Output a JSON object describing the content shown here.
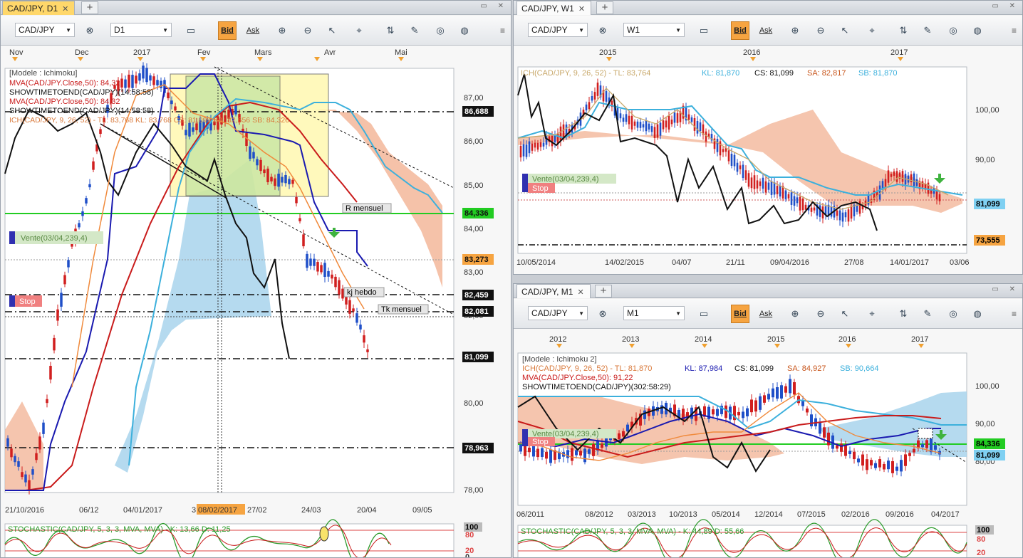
{
  "windows": {
    "d1": {
      "tab_title": "CAD/JPY, D1",
      "symbol": "CAD/JPY",
      "timeframe": "D1",
      "bid_label": "Bid",
      "ask_label": "Ask",
      "top_axis": [
        "Nov",
        "Dec",
        "2017",
        "Fev",
        "Mars",
        "Avr",
        "Mai"
      ],
      "bottom_axis": [
        "21/10/2016",
        "06/12",
        "04/01/2017",
        "3",
        "08/02/2017",
        "27/02",
        "24/03",
        "20/04",
        "09/05"
      ],
      "price_ticks": [
        "87,00",
        "86,00",
        "85,00",
        "84,00",
        "83,00",
        "82,00",
        "80,00",
        "78,00"
      ],
      "price_flags": [
        "86,688",
        "84,336",
        "83,273",
        "82,459",
        "82,081",
        "81,099",
        "78,963"
      ],
      "legend": [
        "[Modele : Ichimoku]",
        "MVA(CAD/JPY.Close,50): 84,32",
        "SHOWTIMETOEND(CAD/JPY)(14:58:58)",
        "MVA(CAD/JPY.Close,50): 84,32",
        "SHOWTIMETOEND(CAD/JPY)(14:58:58)",
        "ICH(CAD/JPY, 9, 26, 52) - TL: 83,768  KL: 83,768  CS: 81,099  SA: 82,656  SB: 84,326"
      ],
      "labels": {
        "r_mensuel": "R mensuel",
        "kj_hebdo": "kj hebdo",
        "tk_mensuel": "Tk mensuel",
        "vente": "Vente(03/04,239,4)",
        "stop": "Stop"
      },
      "stoch_label": "STOCHASTIC(CAD/JPY, 5, 3, 3, MVA, MVA) - K: 13,66  D: 11,25",
      "stoch_ticks": [
        "100",
        "80",
        "20",
        "0"
      ]
    },
    "w1": {
      "tab_title": "CAD/JPY, W1",
      "symbol": "CAD/JPY",
      "timeframe": "W1",
      "bid_label": "Bid",
      "ask_label": "Ask",
      "top_axis": [
        "2015",
        "2016",
        "2017"
      ],
      "bottom_axis": [
        "10/05/2014",
        "14/02/2015",
        "04/07",
        "21/11",
        "09/04/2016",
        "27/08",
        "14/01/2017",
        "03/06"
      ],
      "price_ticks": [
        "100,00",
        "90,00"
      ],
      "price_flags": [
        "81,099",
        "73,555"
      ],
      "legend_parts": [
        "ICH(CAD/JPY, 9, 26, 52) -  TL: 83,764",
        "KL: 81,870",
        "CS: 81,099",
        "SA: 82,817",
        "SB: 81,870"
      ],
      "labels": {
        "vente": "Vente(03/04,239,4)",
        "stop": "Stop"
      }
    },
    "m1": {
      "tab_title": "CAD/JPY, M1",
      "symbol": "CAD/JPY",
      "timeframe": "M1",
      "bid_label": "Bid",
      "ask_label": "Ask",
      "top_axis": [
        "2012",
        "2013",
        "2014",
        "2015",
        "2016",
        "2017"
      ],
      "bottom_axis": [
        "06/2011",
        "08/2012",
        "03/2013",
        "10/2013",
        "05/2014",
        "12/2014",
        "07/2015",
        "02/2016",
        "09/2016",
        "04/2017"
      ],
      "price_ticks": [
        "100,00",
        "90,00",
        "80,00"
      ],
      "price_flags": [
        "84,336",
        "81,099"
      ],
      "legend_title": "[Modele : Ichimoku 2]",
      "legend_ich": [
        "ICH(CAD/JPY, 9, 26, 52) -  TL: 81,870",
        "KL: 87,984",
        "CS: 81,099",
        "SA: 84,927",
        "SB: 90,664"
      ],
      "legend_mva": "MVA(CAD/JPY.Close,50): 91,22",
      "legend_stt": "SHOWTIMETOEND(CAD/JPY)(302:58:29)",
      "labels": {
        "vente": "Vente(03/04,239,4)",
        "stop": "Stop"
      },
      "stoch_label": "STOCHASTIC(CAD/JPY, 5, 3, 3, MVA, MVA) - K: 44,89  D: 55,66",
      "stoch_ticks": [
        "100",
        "80",
        "20"
      ]
    }
  },
  "colors": {
    "active_tab": "#ffd76a",
    "bid": "#f6a441",
    "cloud_up": "#a8d3ec",
    "cloud_down": "#f3b79a",
    "kijun": "#1a1ab0",
    "tenkan": "#3cb0dc",
    "mva": "#c91b1b",
    "support": "#22cc22",
    "candle_up": "#1f4fc8",
    "candle_down": "#d11f1f"
  }
}
